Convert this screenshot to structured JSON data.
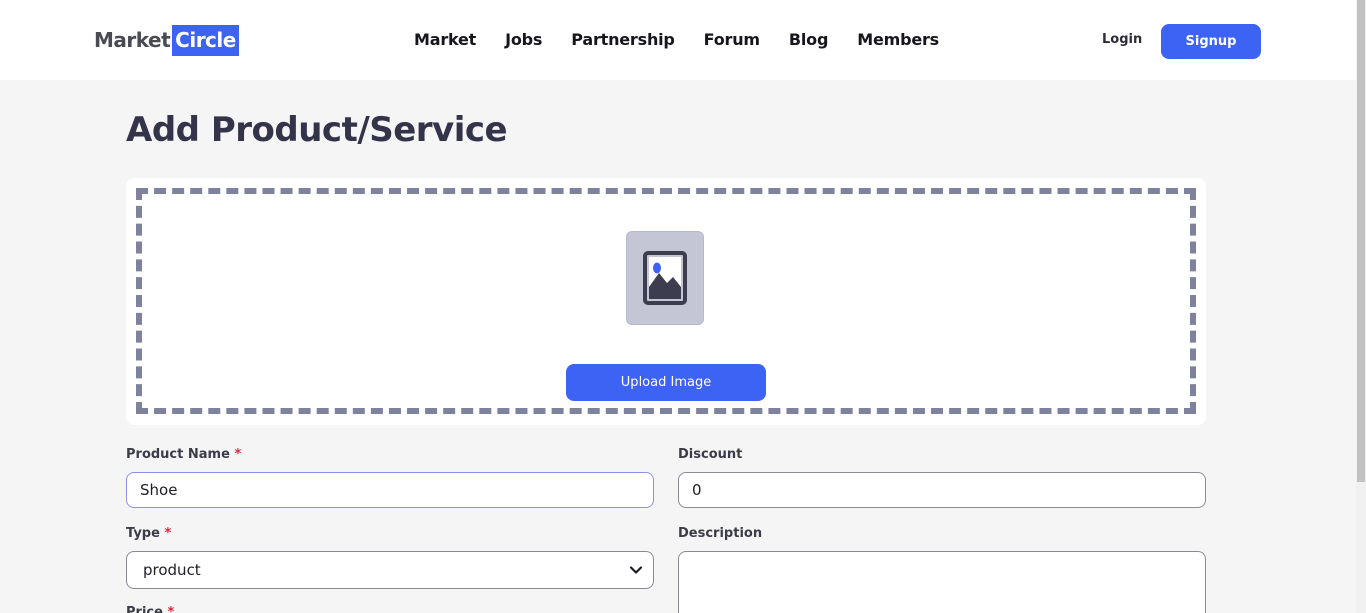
{
  "brand": {
    "part1": "Market",
    "part2": "Circle"
  },
  "nav": {
    "items": [
      {
        "label": "Market"
      },
      {
        "label": "Jobs"
      },
      {
        "label": "Partnership"
      },
      {
        "label": "Forum"
      },
      {
        "label": "Blog"
      },
      {
        "label": "Members"
      }
    ],
    "login_label": "Login",
    "signup_label": "Signup"
  },
  "page": {
    "title": "Add Product/Service"
  },
  "upload": {
    "button_label": "Upload Image",
    "icon": "image-icon"
  },
  "form": {
    "product_name": {
      "label": "Product Name",
      "required_mark": "*",
      "value": "Shoe"
    },
    "discount": {
      "label": "Discount",
      "value": "0"
    },
    "type": {
      "label": "Type",
      "required_mark": "*",
      "selected": "product"
    },
    "description": {
      "label": "Description",
      "value": ""
    },
    "price": {
      "label": "Price",
      "required_mark": "*"
    }
  },
  "colors": {
    "accent": "#3d63f5",
    "required": "#e0243b",
    "dash_border": "#7e829c",
    "page_bg": "#f5f5f5"
  }
}
